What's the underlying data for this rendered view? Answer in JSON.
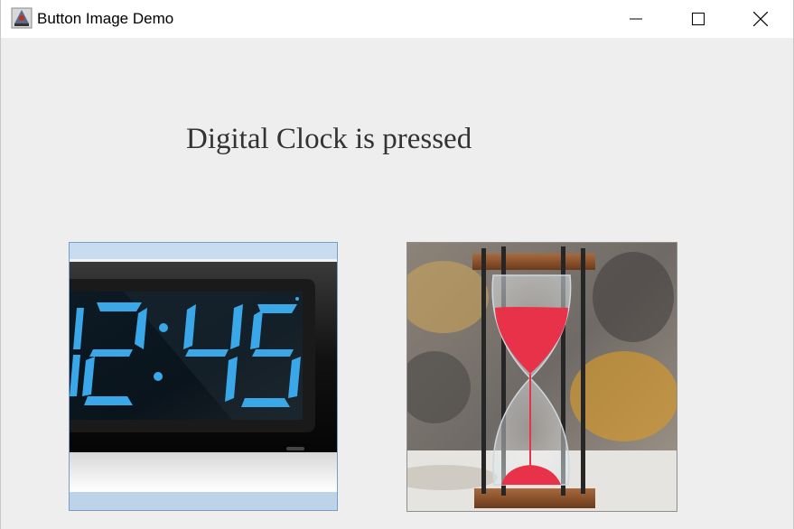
{
  "window": {
    "title": "Button Image Demo",
    "icon": "java-app-icon",
    "controls": [
      "minimize",
      "maximize",
      "close"
    ]
  },
  "status_label": "Digital Clock is pressed",
  "buttons": [
    {
      "name": "digital-clock-button",
      "image": "digital-clock-image",
      "clock_display": "12:45",
      "pressed": true
    },
    {
      "name": "hourglass-button",
      "image": "hourglass-image",
      "pressed": false
    }
  ],
  "colors": {
    "clock_digits": "#3aa8e8",
    "pressed_border": "#7a9cc6",
    "pressed_fill": "#b9d1ea",
    "sand": "#e8324a"
  }
}
